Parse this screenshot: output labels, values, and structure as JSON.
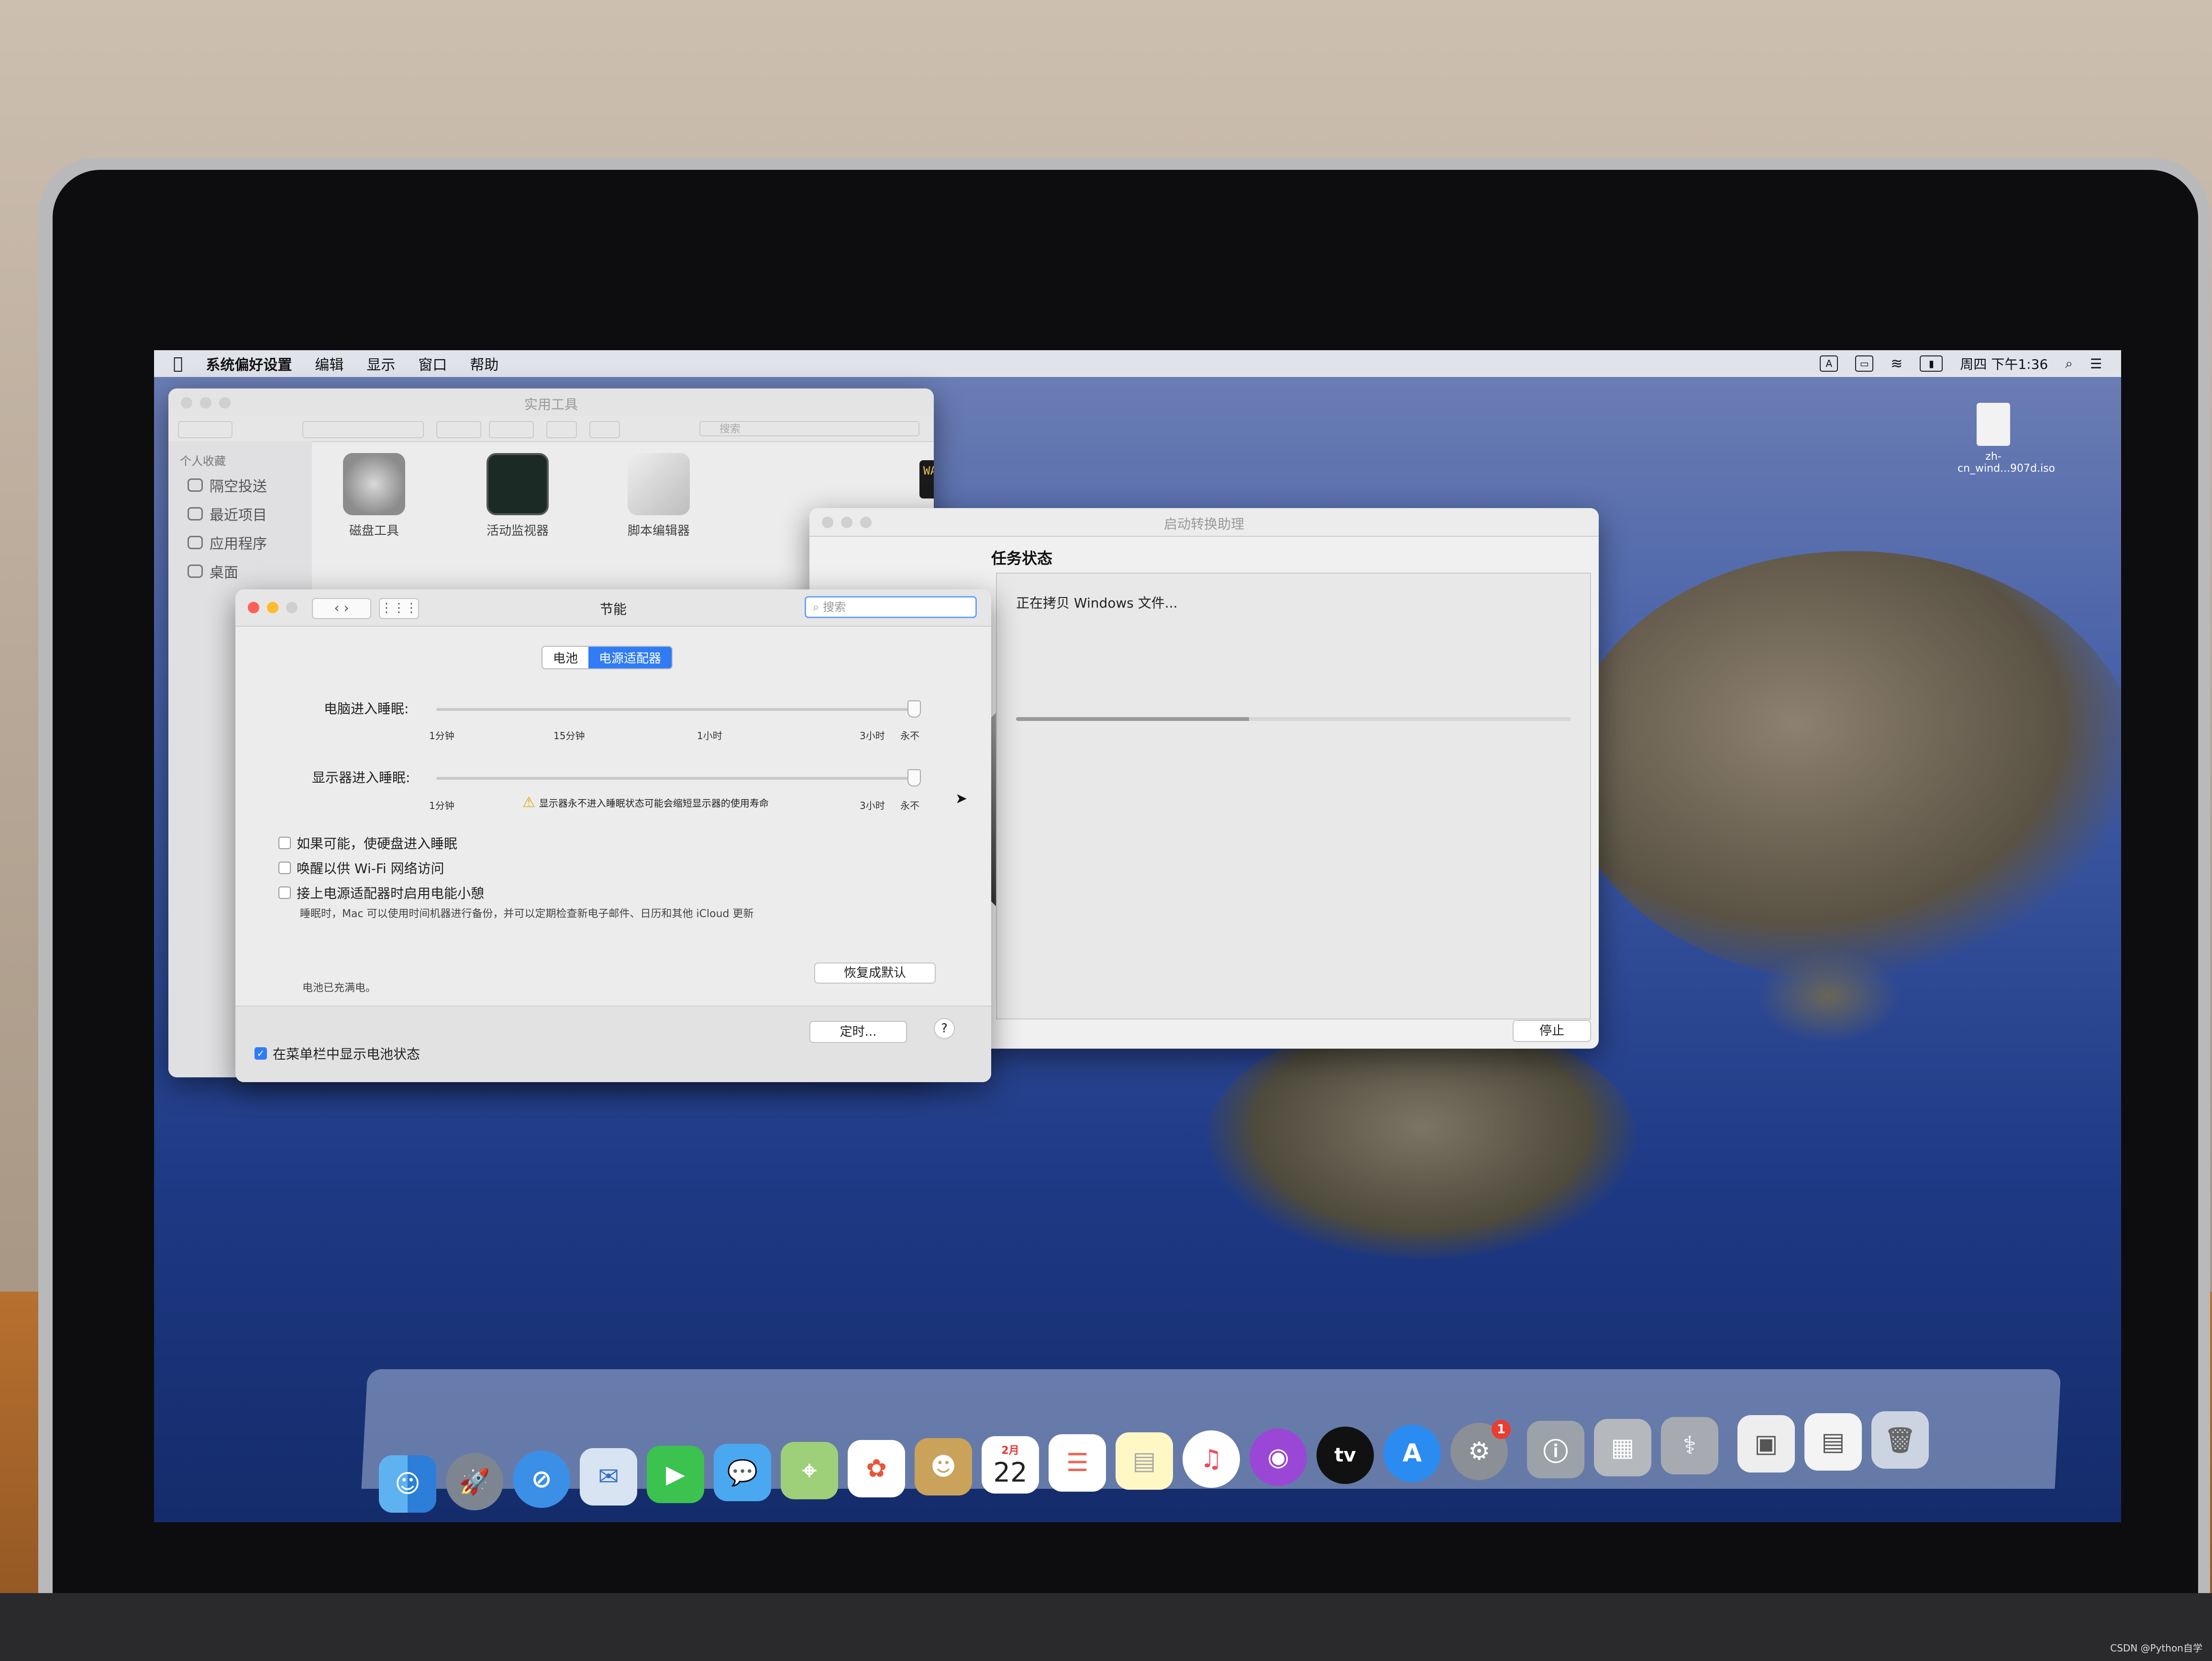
{
  "menubar": {
    "app_name": "系统偏好设置",
    "items": [
      "编辑",
      "显示",
      "窗口",
      "帮助"
    ],
    "clock": "周四 下午1:36",
    "input_indicator": "A"
  },
  "desktop": {
    "file_name_line1": "zh-",
    "file_name_line2": "cn_wind...907d.iso"
  },
  "finder": {
    "title": "实用工具",
    "search_placeholder": "搜索",
    "sidebar_header": "个人收藏",
    "sidebar_items": [
      "隔空投送",
      "最近项目",
      "应用程序",
      "桌面"
    ],
    "apps": [
      "磁盘工具",
      "活动监视器",
      "脚本编辑器"
    ],
    "partial_app_badge": "WARNI"
  },
  "energy": {
    "title": "节能",
    "search_placeholder": "搜索",
    "tabs": [
      "电池",
      "电源适配器"
    ],
    "selected_tab": 1,
    "computer_sleep_label": "电脑进入睡眠:",
    "display_sleep_label": "显示器进入睡眠:",
    "ticks_computer": [
      "1分钟",
      "15分钟",
      "1小时",
      "3小时",
      "永不"
    ],
    "ticks_display": [
      "1分钟",
      "3小时",
      "永不"
    ],
    "warning": "显示器永不进入睡眠状态可能会缩短显示器的使用寿命",
    "checkboxes": [
      {
        "label": "如果可能，使硬盘进入睡眠",
        "checked": false
      },
      {
        "label": "唤醒以供 Wi-Fi 网络访问",
        "checked": false
      },
      {
        "label": "接上电源适配器时启用电能小憩",
        "checked": false
      }
    ],
    "powernap_desc": "睡眠时，Mac 可以使用时间机器进行备份，并可以定期检查新电子邮件、日历和其他 iCloud 更新",
    "restore_button": "恢复成默认",
    "battery_status": "电池已充满电。",
    "schedule_button": "定时...",
    "help_button": "?",
    "show_battery_label": "在菜单栏中显示电池状态",
    "show_battery_checked": true
  },
  "bootcamp": {
    "title": "启动转换助理",
    "heading": "任务状态",
    "status": "正在拷贝 Windows 文件...",
    "progress": 0.42,
    "stop_button": "停止"
  },
  "dock": {
    "apps": [
      "finder-icon",
      "launchpad-icon",
      "safari-icon",
      "mail-icon",
      "facetime-icon",
      "messages-icon",
      "maps-icon",
      "photos-icon",
      "contacts-icon",
      "calendar-icon",
      "reminders-icon",
      "notes-icon",
      "music-icon",
      "podcasts-icon",
      "tv-icon",
      "app-store-icon",
      "system-preferences-icon",
      "boot-camp-icon",
      "disk-utility-icon",
      "iso-file-icon",
      "document-icon",
      "trash-icon"
    ],
    "calendar_month": "2月",
    "calendar_day": "22",
    "tv_label": "tv",
    "prefs_badge": "1"
  },
  "watermark": "CSDN @Python自学"
}
